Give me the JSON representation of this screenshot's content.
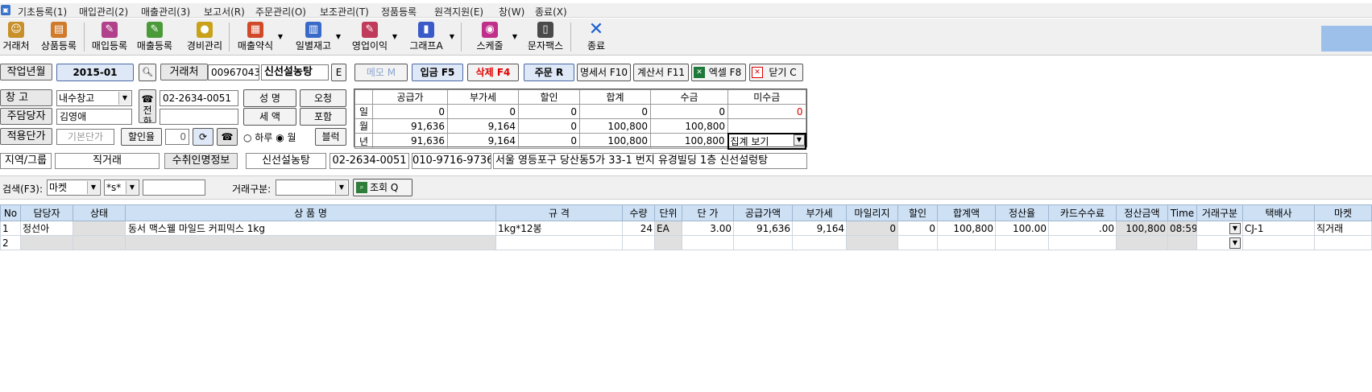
{
  "menu": [
    "기초등록(1)",
    "매입관리(2)",
    "매출관리(3)",
    "보고서(R)",
    "주문관리(O)",
    "보조관리(T)",
    "정품등록",
    "원격지원(E)",
    "창(W)",
    "종료(X)"
  ],
  "toolbar": [
    {
      "label": "거래처",
      "icon": "handshake-icon",
      "color": "#c8902a"
    },
    {
      "label": "상품등록",
      "icon": "product-icon",
      "color": "#d07a2a"
    },
    {
      "label": "매입등록",
      "icon": "purchase-doc-icon",
      "color": "#b0418a"
    },
    {
      "label": "매출등록",
      "icon": "sales-doc-icon",
      "color": "#4a9a3a"
    },
    {
      "label": "경비관리",
      "icon": "coins-icon",
      "color": "#c9a21a"
    },
    {
      "label": "매출약식",
      "icon": "sales-simple-icon",
      "color": "#d04a2a"
    },
    {
      "label": "일별재고",
      "icon": "daily-stock-icon",
      "color": "#3a6ac9"
    },
    {
      "label": "영업이익",
      "icon": "profit-icon",
      "color": "#c03a5a"
    },
    {
      "label": "그래프A",
      "icon": "graph-icon",
      "color": "#3a5ac9"
    },
    {
      "label": "스케줄",
      "icon": "schedule-icon",
      "color": "#c0308a"
    },
    {
      "label": "문자팩스",
      "icon": "sms-fax-icon",
      "color": "#4a4a4a"
    },
    {
      "label": "종료",
      "icon": "exit-x-icon",
      "color": "#1a5fd0"
    }
  ],
  "header": {
    "work_ym_label": "작업년월",
    "work_ym": "2015-01",
    "client_label": "거래처",
    "client_code": "00967043",
    "client_name": "신선설농탕",
    "e_btn": "E",
    "memo": "메모 M",
    "ipgum": "입금 F5",
    "delete": "삭제 F4",
    "order": "주문 R",
    "statement": "명세서 F10",
    "invoice": "계산서 F11",
    "excel": "엑셀 F8",
    "close": "닫기 C",
    "warehouse_label": "창   고",
    "warehouse": "내수창고",
    "phone_label": "전화",
    "phone": "02-2634-0051",
    "name_label": "성 명",
    "name_btn": "오청",
    "manager_label": "주담당자",
    "manager": "김영애",
    "tax_label": "세 액",
    "tax_btn": "포함",
    "price_label": "적용단가",
    "price_value": "기본단가",
    "discount_label": "할인율",
    "discount": "0",
    "radio_day": "하루",
    "radio_month": "월",
    "block": "블럭"
  },
  "summary": {
    "headers": [
      "공급가",
      "부가세",
      "할인",
      "합계",
      "수금",
      "미수금"
    ],
    "rows": [
      {
        "label": "일",
        "values": [
          "0",
          "0",
          "0",
          "0",
          "0",
          "0"
        ]
      },
      {
        "label": "월",
        "values": [
          "91,636",
          "9,164",
          "0",
          "100,800",
          "100,800",
          ""
        ]
      },
      {
        "label": "년",
        "values": [
          "91,636",
          "9,164",
          "0",
          "100,800",
          "100,800",
          ""
        ]
      }
    ],
    "view_select": "집계 보기"
  },
  "info_bar": [
    "지역/그룹",
    "직거래",
    "수취인명정보",
    "신선설농탕",
    "02-2634-0051",
    "010-9716-9736",
    "서울 영등포구 당산동5가 33-1 번지 유경빌딩 1층 신선설렁탕"
  ],
  "search": {
    "label": "검색(F3):",
    "field": "마켓",
    "mode": "*s*",
    "value": "",
    "type_label": "거래구분:",
    "type_value": "",
    "query_btn": "조회 Q"
  },
  "grid": {
    "columns": [
      "No",
      "담당자",
      "상태",
      "상 품 명",
      "규 격",
      "수량",
      "단위",
      "단 가",
      "공급가액",
      "부가세",
      "마일리지",
      "할인",
      "합계액",
      "정산율",
      "카드수수료",
      "정산금액",
      "Time",
      "거래구분",
      "택배사",
      "마켓"
    ],
    "rows": [
      [
        "1",
        "정선아",
        "",
        "동서 맥스웰 마일드 커피믹스 1kg",
        "1kg*12봉",
        "24",
        "EA",
        "3.00",
        "91,636",
        "9,164",
        "0",
        "0",
        "100,800",
        "100.00",
        ".00",
        "100,800",
        "08:59",
        "",
        "CJ-1",
        "직거래"
      ],
      [
        "2",
        "",
        "",
        "",
        "",
        "",
        "",
        "",
        "",
        "",
        "",
        "",
        "",
        "",
        "",
        "",
        "",
        "",
        "",
        ""
      ]
    ]
  }
}
